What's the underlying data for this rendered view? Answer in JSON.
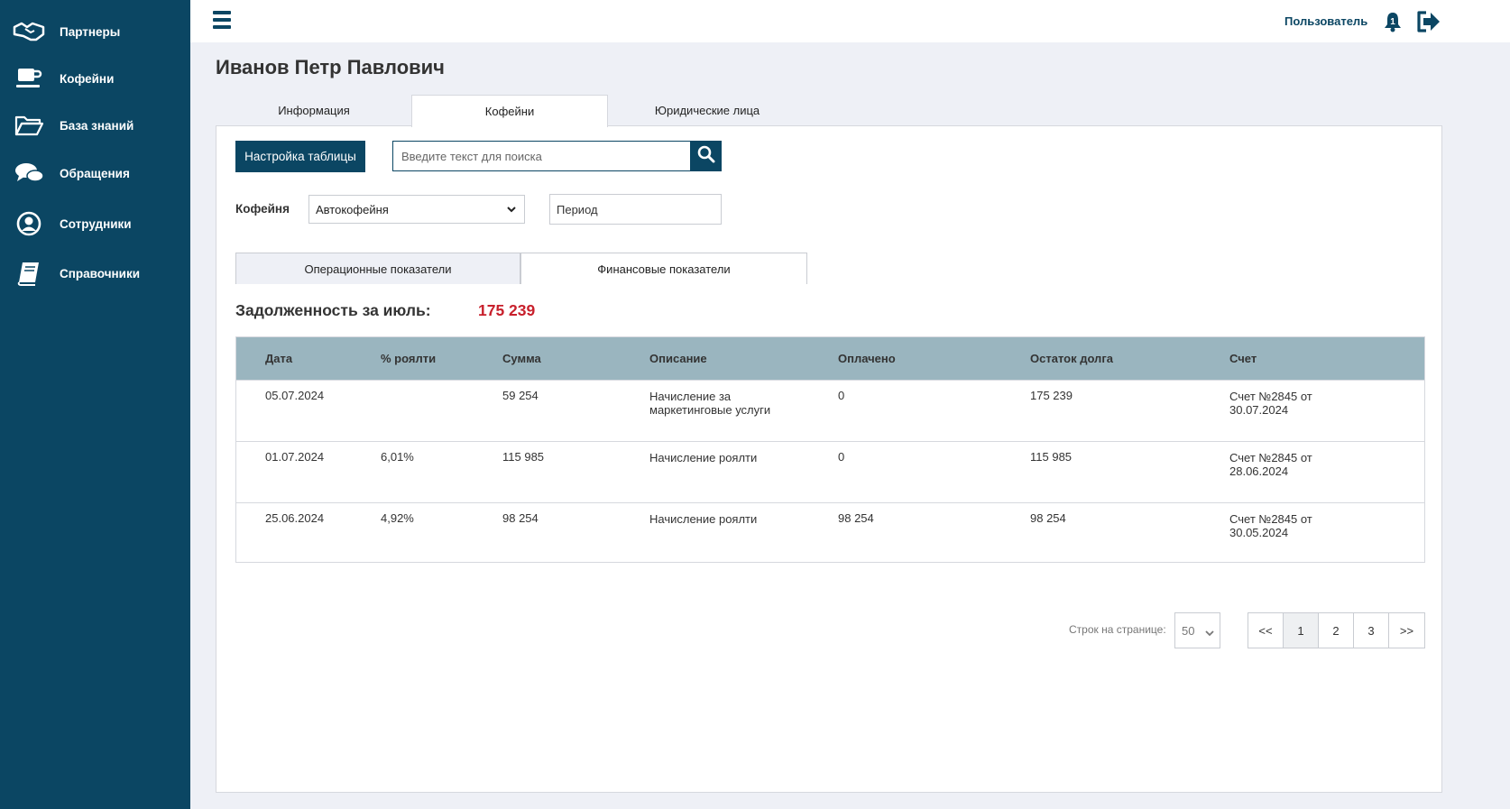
{
  "sidebar": {
    "items": [
      {
        "label": "Партнеры",
        "icon": "handshake-icon"
      },
      {
        "label": "Кофейни",
        "icon": "coffee-cup-icon"
      },
      {
        "label": "База знаний",
        "icon": "folder-icon"
      },
      {
        "label": "Обращения",
        "icon": "chat-icon"
      },
      {
        "label": "Сотрудники",
        "icon": "user-circle-icon"
      },
      {
        "label": "Справочники",
        "icon": "book-icon"
      }
    ]
  },
  "topbar": {
    "user_label": "Пользователь",
    "notification_count": "1"
  },
  "page": {
    "title": "Иванов Петр Павлович"
  },
  "tabs": [
    {
      "label": "Информация",
      "active": false
    },
    {
      "label": "Кофейни",
      "active": true
    },
    {
      "label": "Юридические лица",
      "active": false
    }
  ],
  "toolbar": {
    "settings_label": "Настройка таблицы",
    "search_placeholder": "Введите текст для поиска"
  },
  "filters": {
    "coffee_label": "Кофейня",
    "coffee_value": "Автокофейня",
    "period_placeholder": "Период"
  },
  "subtabs": [
    {
      "label": "Операционные показатели",
      "active": false
    },
    {
      "label": "Финансовые показатели",
      "active": true
    }
  ],
  "debt": {
    "label": "Задолженность за июль:",
    "value": "175 239"
  },
  "table": {
    "columns": [
      "Дата",
      "% роялти",
      "Сумма",
      "Описание",
      "Оплачено",
      "Остаток долга",
      "Счет"
    ],
    "rows": [
      {
        "date": "05.07.2024",
        "royalty": "",
        "sum": "59 254",
        "desc1": "Начисление за",
        "desc2": "маркетинговые услуги",
        "paid": "0",
        "rest": "175 239",
        "inv1": "Счет №2845 от",
        "inv2": "30.07.2024"
      },
      {
        "date": "01.07.2024",
        "royalty": "6,01%",
        "sum": "115 985",
        "desc1": "Начисление роялти",
        "desc2": "",
        "paid": "0",
        "rest": "115 985",
        "inv1": "Счет №2845 от",
        "inv2": "28.06.2024"
      },
      {
        "date": "25.06.2024",
        "royalty": "4,92%",
        "sum": "98 254",
        "desc1": "Начисление роялти",
        "desc2": "",
        "paid": "98 254",
        "rest": "98 254",
        "inv1": "Счет №2845 от",
        "inv2": "30.05.2024"
      }
    ]
  },
  "pagination": {
    "rows_label": "Строк на странице:",
    "rows_value": "50",
    "first": "<<",
    "pages": [
      "1",
      "2",
      "3"
    ],
    "current_page": "1",
    "last": ">>"
  },
  "colors": {
    "sidebar": "#0b4663",
    "accent": "#0b4663",
    "debt": "#c8202c",
    "table_header": "#9ab5bf"
  }
}
